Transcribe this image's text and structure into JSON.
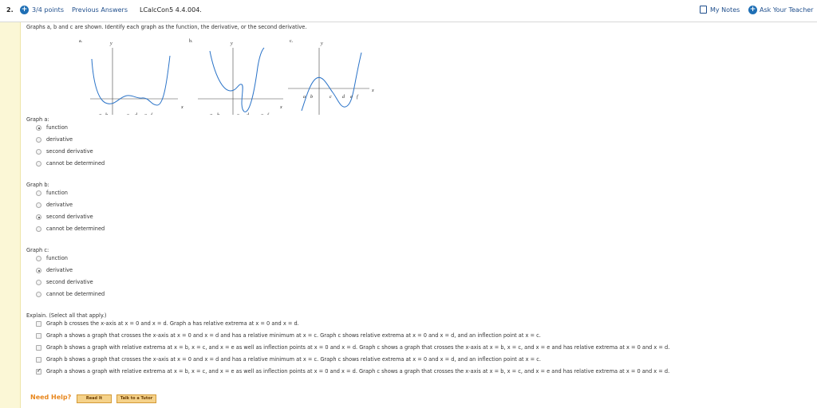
{
  "header": {
    "question_number": "2.",
    "points": "3/4 points",
    "previous_answers": "Previous Answers",
    "question_code": "LCalcCon5 4.4.004.",
    "my_notes": "My Notes",
    "ask_teacher": "Ask Your Teacher"
  },
  "prompt": "Graphs a, b and c are shown. Identify each graph as the function, the derivative, or the second derivative.",
  "figure": {
    "graph_a": {
      "letter": "a.",
      "y": "y",
      "x": "x",
      "ticks": [
        "a",
        "b",
        "c",
        "d",
        "e",
        "f"
      ]
    },
    "graph_b": {
      "letter": "b.",
      "y": "y",
      "x": "x",
      "ticks": [
        "a",
        "b",
        "c",
        "d",
        "e",
        "f"
      ]
    },
    "graph_c": {
      "letter": "c.",
      "y": "y",
      "x": "x",
      "ticks": [
        "a",
        "b",
        "c",
        "d",
        "e",
        "f"
      ]
    }
  },
  "groups": [
    {
      "label": "Graph a:",
      "options": [
        "function",
        "derivative",
        "second derivative",
        "cannot be determined"
      ],
      "selected": 0
    },
    {
      "label": "Graph b:",
      "options": [
        "function",
        "derivative",
        "second derivative",
        "cannot be determined"
      ],
      "selected": 2
    },
    {
      "label": "Graph c:",
      "options": [
        "function",
        "derivative",
        "second derivative",
        "cannot be determined"
      ],
      "selected": 1
    }
  ],
  "explain": {
    "label": "Explain. (Select all that apply.)",
    "items": [
      {
        "text": "Graph b crosses the x-axis at x = 0 and x = d. Graph a has relative extrema at x = 0 and x = d.",
        "checked": false
      },
      {
        "text": "Graph a shows a graph that crosses the x-axis at x = 0 and x = d and has a relative minimum at x = c. Graph c shows relative extrema at x = 0 and x = d, and an inflection point at x = c.",
        "checked": false
      },
      {
        "text": "Graph b shows a graph with relative extrema at x = b, x = c, and x = e as well as inflection points at x = 0 and x = d. Graph c shows a graph that crosses the x-axis at x = b, x = c, and x = e and has relative extrema at x = 0 and x = d.",
        "checked": false
      },
      {
        "text": "Graph b shows a graph that crosses the x-axis at x = 0 and x = d and has a relative minimum at x = c. Graph c shows relative extrema at x = 0 and x = d, and an inflection point at x = c.",
        "checked": false
      },
      {
        "text": "Graph a shows a graph with relative extrema at x = b, x = c, and x = e as well as inflection points at x = 0 and x = d. Graph c shows a graph that crosses the x-axis at x = b, x = c, and x = e and has relative extrema at x = 0 and x = d.",
        "checked": true
      }
    ]
  },
  "help": {
    "label": "Need Help?",
    "read_it": "Read It",
    "talk_tutor": "Talk to a Tutor"
  },
  "colors": {
    "link": "#1f4e8c",
    "curve": "#2a73c8",
    "help": "#e8871e",
    "accent": "#1f6fb5"
  }
}
